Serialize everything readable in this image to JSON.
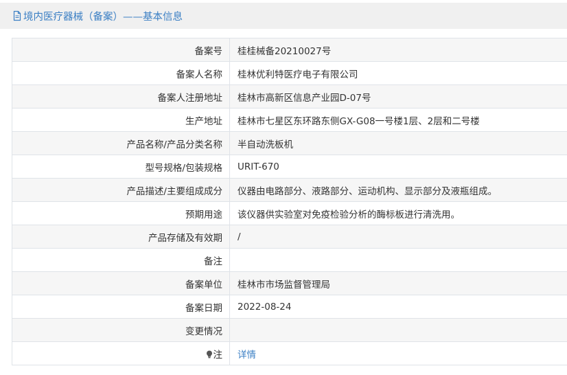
{
  "header": {
    "title": "境内医疗器械（备案）——基本信息"
  },
  "rows": [
    {
      "label": "备案号",
      "value": "桂桂械备20210027号"
    },
    {
      "label": "备案人名称",
      "value": "桂林优利特医疗电子有限公司"
    },
    {
      "label": "备案人注册地址",
      "value": "桂林市高新区信息产业园D-07号"
    },
    {
      "label": "生产地址",
      "value": "桂林市七星区东环路东侧GX-G08一号楼1层、2层和二号楼"
    },
    {
      "label": "产品名称/产品分类名称",
      "value": "半自动洗板机"
    },
    {
      "label": "型号规格/包装规格",
      "value": "URIT-670"
    },
    {
      "label": "产品描述/主要组成成分",
      "value": "仪器由电路部分、液路部分、运动机构、显示部分及液瓶组成。"
    },
    {
      "label": "预期用途",
      "value": "该仪器供实验室对免疫检验分析的酶标板进行清洗用。"
    },
    {
      "label": "产品存储及有效期",
      "value": "/"
    },
    {
      "label": "备注",
      "value": ""
    },
    {
      "label": "备案单位",
      "value": "桂林市市场监督管理局"
    },
    {
      "label": "备案日期",
      "value": "2022-08-24"
    },
    {
      "label": "变更情况",
      "value": ""
    }
  ],
  "note_row": {
    "label": "注",
    "icon": "lightbulb-icon",
    "link_text": "详情"
  },
  "colors": {
    "accent": "#3b7fc4",
    "title_bg": "#f0f0f0",
    "row_alt_bg": "#f6f6f6",
    "border": "#dfe3e8",
    "text": "#333333"
  }
}
